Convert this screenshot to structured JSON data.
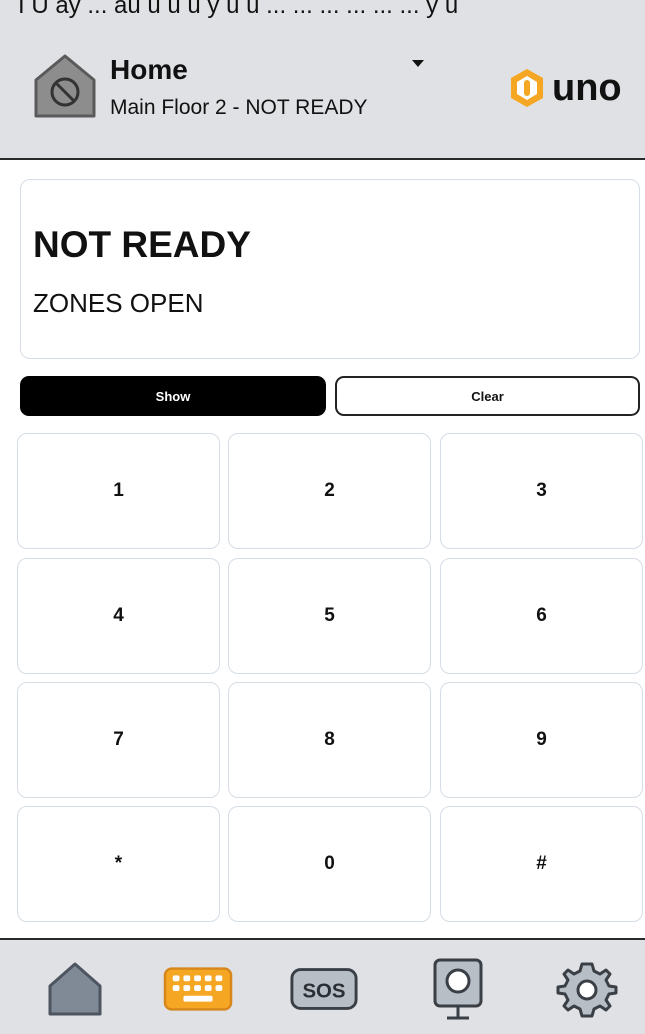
{
  "top_clip_text": "I U ay ... au u u u y u u ... ... ... ... ... ... y u",
  "header": {
    "site_name": "Home",
    "site_status": "Main Floor 2 - NOT READY",
    "logo_text": "uno"
  },
  "status": {
    "title": "NOT READY",
    "subtitle": "ZONES OPEN"
  },
  "actions": {
    "show_label": "Show",
    "clear_label": "Clear"
  },
  "keypad": {
    "keys": [
      "1",
      "2",
      "3",
      "4",
      "5",
      "6",
      "7",
      "8",
      "9",
      "*",
      "0",
      "#"
    ]
  },
  "bottom_nav": {
    "items": [
      "home-icon",
      "keyboard-icon",
      "sos-icon",
      "camera-icon",
      "settings-icon"
    ],
    "active": "keyboard-icon",
    "sos_label": "SOS"
  },
  "colors": {
    "header_bg": "#dfe1e4",
    "accent_orange": "#f5a623",
    "card_border": "#d6dde5",
    "icon_gray": "#7f8a96"
  }
}
